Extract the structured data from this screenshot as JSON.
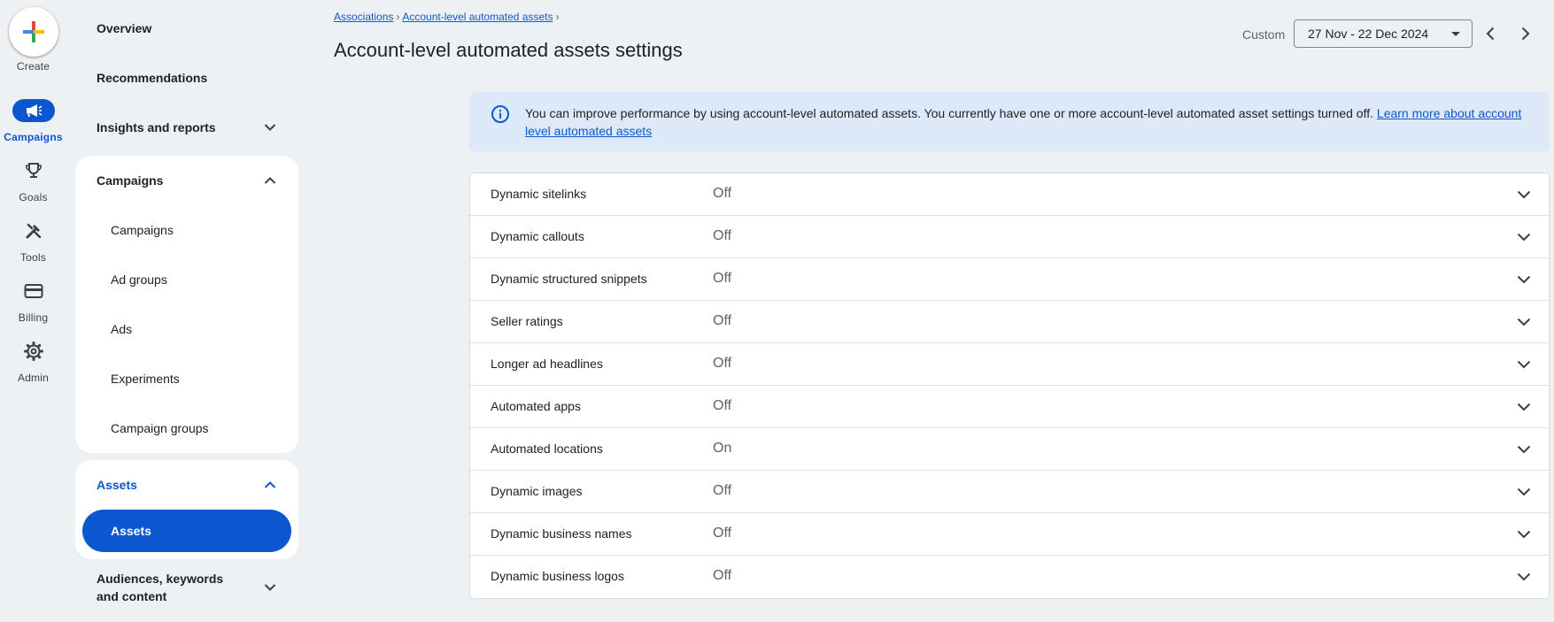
{
  "rail": {
    "create_label": "Create",
    "items": [
      {
        "label": "Campaigns",
        "icon": "campaigns-megaphone-icon",
        "active": true
      },
      {
        "label": "Goals",
        "icon": "trophy-icon",
        "active": false
      },
      {
        "label": "Tools",
        "icon": "tools-icon",
        "active": false
      },
      {
        "label": "Billing",
        "icon": "credit-card-icon",
        "active": false
      },
      {
        "label": "Admin",
        "icon": "gear-icon",
        "active": false
      }
    ]
  },
  "nav": {
    "overview": "Overview",
    "recommendations": "Recommendations",
    "insights": "Insights and reports",
    "campaigns_group": "Campaigns",
    "campaigns_sub": [
      "Campaigns",
      "Ad groups",
      "Ads",
      "Experiments",
      "Campaign groups"
    ],
    "assets_group": "Assets",
    "assets_sub": "Assets",
    "audiences": "Audiences, keywords and content"
  },
  "header": {
    "breadcrumb": [
      "Associations",
      "Account-level automated assets"
    ],
    "title": "Account-level automated assets settings",
    "date_label": "Custom",
    "date_range": "27 Nov - 22 Dec 2024"
  },
  "banner": {
    "text": "You can improve performance by using account-level automated assets. You currently have one or more account-level automated asset settings turned off.",
    "link": "Learn more about account level automated assets"
  },
  "settings": [
    {
      "name": "Dynamic sitelinks",
      "status": "Off"
    },
    {
      "name": "Dynamic callouts",
      "status": "Off"
    },
    {
      "name": "Dynamic structured snippets",
      "status": "Off"
    },
    {
      "name": "Seller ratings",
      "status": "Off"
    },
    {
      "name": "Longer ad headlines",
      "status": "Off"
    },
    {
      "name": "Automated apps",
      "status": "Off"
    },
    {
      "name": "Automated locations",
      "status": "On"
    },
    {
      "name": "Dynamic images",
      "status": "Off"
    },
    {
      "name": "Dynamic business names",
      "status": "Off"
    },
    {
      "name": "Dynamic business logos",
      "status": "Off"
    }
  ],
  "colors": {
    "accent": "#0b57d0",
    "background": "#eef1f4",
    "banner": "#dde9f9"
  }
}
